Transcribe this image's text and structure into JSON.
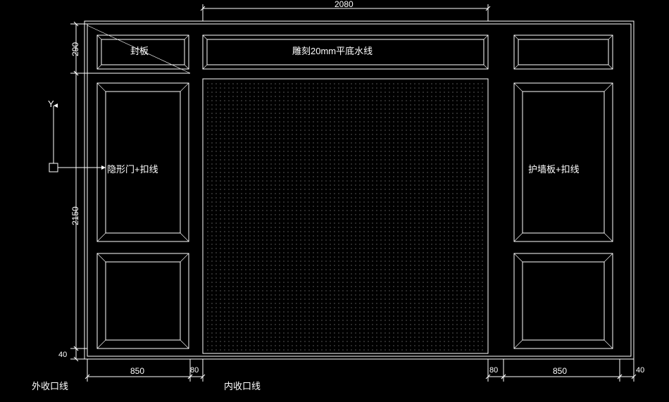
{
  "dimensions": {
    "width_top": "2080",
    "height_top_panel": "290",
    "height_main": "2150",
    "bottom_gap": "40",
    "left_panel_w": "850",
    "left_gap": "80",
    "right_gap": "80",
    "right_panel_w": "850",
    "right_edge": "40"
  },
  "labels": {
    "seal_panel": "封板",
    "carving_line": "雕刻20mm平底水线",
    "hidden_door": "隐形门+扣线",
    "wall_panel": "护墙板+扣线",
    "outer_line": "外收口线",
    "inner_line": "内收口线",
    "y_axis": "Y"
  }
}
